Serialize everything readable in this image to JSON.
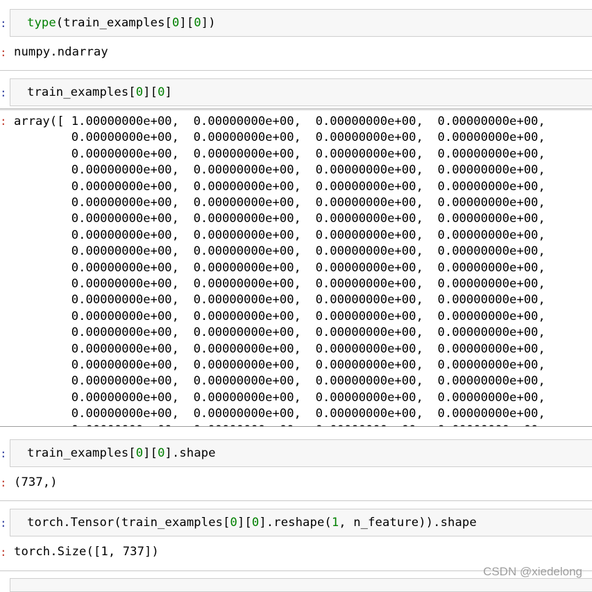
{
  "cells": [
    {
      "input": {
        "pre": "",
        "fn": "type",
        "mid": "(train_examples[",
        "n1": "0",
        "b1": "][",
        "n2": "0",
        "post": "])"
      },
      "output": "numpy.ndarray"
    },
    {
      "input": {
        "pre": "train_examples[",
        "n1": "0",
        "b1": "][",
        "n2": "0",
        "post": "]"
      },
      "output_first": "array([ 1.00000000e+00,  0.00000000e+00,  0.00000000e+00,  0.00000000e+00,",
      "output_row": "        0.00000000e+00,  0.00000000e+00,  0.00000000e+00,  0.00000000e+00,"
    },
    {
      "input": {
        "pre": "train_examples[",
        "n1": "0",
        "b1": "][",
        "n2": "0",
        "post": "].shape"
      },
      "output": "(737,)"
    },
    {
      "input": {
        "pre": "torch.Tensor(train_examples[",
        "n1": "0",
        "b1": "][",
        "n2": "0",
        "mid": "].reshape(",
        "n3": "1",
        "post": ", n_feature)).shape"
      },
      "output": "torch.Size([1, 737])"
    }
  ],
  "prompt_glyph": ":",
  "watermark": "CSDN @xiedelong"
}
